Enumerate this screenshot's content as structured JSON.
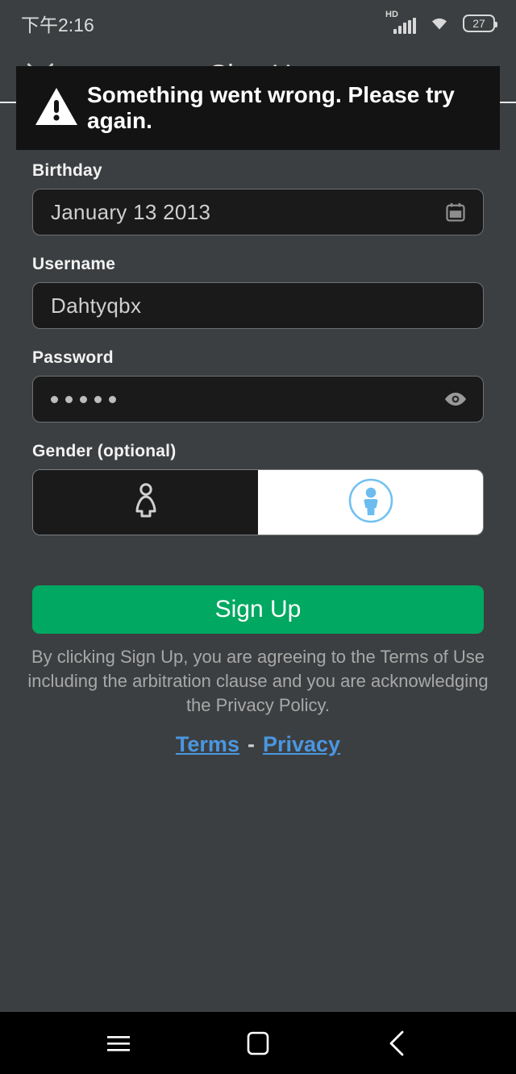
{
  "status_bar": {
    "time": "下午2:16",
    "network_label": "HD",
    "battery_level": "27",
    "icons": [
      "hd-signal-icon",
      "wifi-icon",
      "battery-icon"
    ]
  },
  "header": {
    "title": "Sign Up",
    "close_icon": "close-icon"
  },
  "toast": {
    "message": "Something went wrong. Please try again.",
    "icon": "warning-triangle-icon",
    "background": "#131313"
  },
  "form": {
    "birthday": {
      "label": "Birthday",
      "value": "January 13 2013",
      "icon": "calendar-icon"
    },
    "username": {
      "label": "Username",
      "value": "Dahtyqbx",
      "placeholder": "Username"
    },
    "password": {
      "label": "Password",
      "masked_value": "•••••",
      "dot_count": 5,
      "icon": "eye-icon"
    },
    "gender": {
      "label": "Gender (optional)",
      "options": [
        {
          "name": "female",
          "icon": "person-outline-icon",
          "selected": false
        },
        {
          "name": "male",
          "icon": "person-in-circle-icon",
          "selected": true
        }
      ]
    }
  },
  "actions": {
    "signup_label": "Sign Up",
    "signup_color": "#00a861",
    "disclaimer": "By clicking Sign Up, you are agreeing to the Terms of Use including the arbitration clause and you are acknowledging the Privacy Policy.",
    "terms_label": "Terms",
    "separator": "-",
    "privacy_label": "Privacy",
    "link_color": "#4a97e0"
  },
  "navbar": {
    "recents_icon": "menu-icon",
    "home_icon": "square-icon",
    "back_icon": "chevron-left-icon"
  }
}
